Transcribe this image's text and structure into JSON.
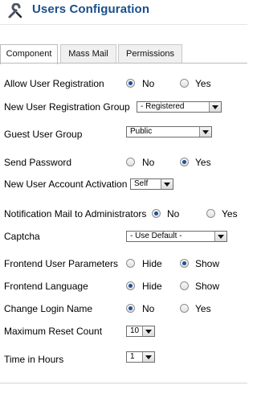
{
  "header": {
    "title": "Users Configuration",
    "icon": "wrench-icon"
  },
  "tabs": [
    {
      "label": "Component",
      "active": true
    },
    {
      "label": "Mass Mail",
      "active": false
    },
    {
      "label": "Permissions",
      "active": false
    }
  ],
  "fields": {
    "allow_user_registration": {
      "label": "Allow User Registration",
      "options": [
        "No",
        "Yes"
      ],
      "selected": "No"
    },
    "new_user_registration_group": {
      "label": "New User Registration Group",
      "value": "- Registered"
    },
    "guest_user_group": {
      "label": "Guest User Group",
      "value": "Public"
    },
    "send_password": {
      "label": "Send Password",
      "options": [
        "No",
        "Yes"
      ],
      "selected": "Yes"
    },
    "new_user_account_activation": {
      "label": "New User Account Activation",
      "value": "Self"
    },
    "notification_mail": {
      "label": "Notification Mail to Administrators",
      "options": [
        "No",
        "Yes"
      ],
      "selected": "No"
    },
    "captcha": {
      "label": "Captcha",
      "value": "- Use Default -"
    },
    "frontend_user_parameters": {
      "label": "Frontend User Parameters",
      "options": [
        "Hide",
        "Show"
      ],
      "selected": "Show"
    },
    "frontend_language": {
      "label": "Frontend Language",
      "options": [
        "Hide",
        "Show"
      ],
      "selected": "Hide"
    },
    "change_login_name": {
      "label": "Change Login Name",
      "options": [
        "No",
        "Yes"
      ],
      "selected": "No"
    },
    "maximum_reset_count": {
      "label": "Maximum Reset Count",
      "value": "10"
    },
    "time_in_hours": {
      "label": "Time in Hours",
      "value": "1"
    }
  },
  "colors": {
    "title": "#1a4f8b",
    "radio_dot": "#1d4f9c"
  }
}
